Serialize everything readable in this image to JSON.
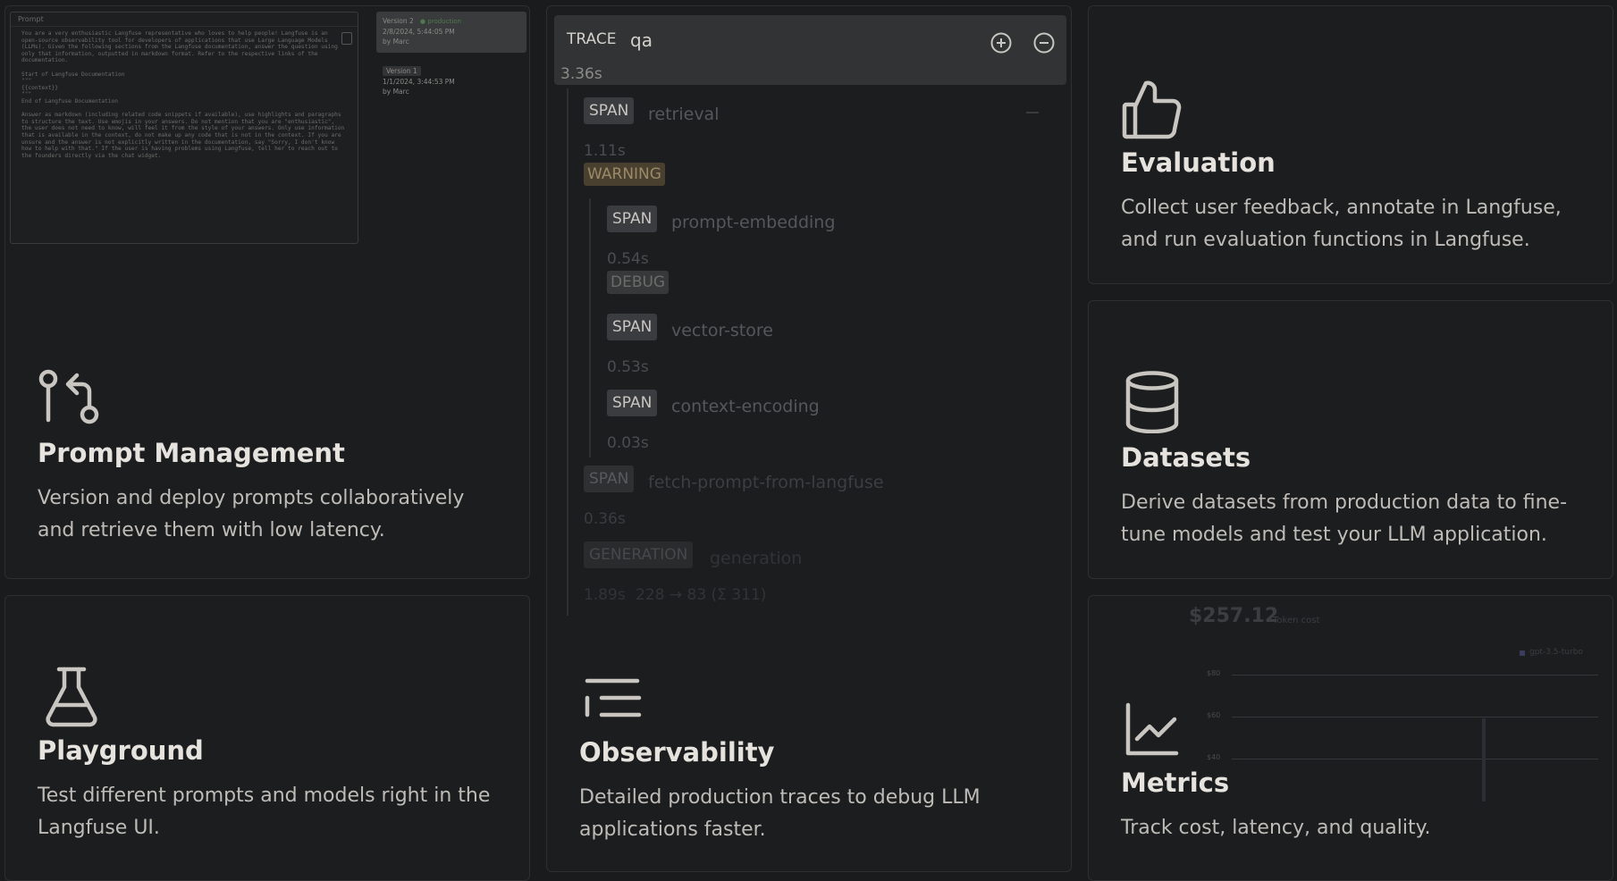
{
  "colors": {
    "background": "#1a1b1d",
    "card": "#1c1d1f",
    "border": "#2e2f31",
    "warning": "#e8b56a",
    "production": "#4caf50"
  },
  "prompt_management": {
    "title": "Prompt Management",
    "description": "Version and deploy prompts collaboratively and retrieve them with low latency.",
    "icon": "git-pull-request-icon",
    "preview": {
      "editor_label": "Prompt",
      "prompt_text": "You are a very enthusiastic Langfuse representative who loves to help people! Langfuse is an open-source observability tool for developers of applications that use Large Language Models (LLMs). Given the following sections from the Langfuse documentation, answer the question using only that information, outputted in markdown format. Refer to the respective links of the documentation.\n\nStart of Langfuse Documentation\n\"\"\"\n{{context}}\n\"\"\"\nEnd of Langfuse Documentation\n\nAnswer as markdown (including related code snippets if available), use highlights and paragraphs to structure the text. Use emojis in your answers. Do not mention that you are \"enthusiastic\", the user does not need to know, will feel it from the style of your answers. Only use information that is available in the context, do not make up any code that is not in the context. If you are unsure and the answer is not explicitly written in the documentation, say \"Sorry, I don't know how to help with that.\" If the user is having problems using Langfuse, tell her to reach out to the founders directly via the chat widget.",
      "versions": [
        {
          "label": "Version 2",
          "tag": "production",
          "date": "2/8/2024, 5:44:05 PM",
          "author": "by Marc"
        },
        {
          "label": "Version 1",
          "date": "1/1/2024, 3:44:53 PM",
          "author": "by Marc"
        }
      ]
    }
  },
  "observability": {
    "title": "Observability",
    "description": "Detailed production traces to debug LLM applications faster.",
    "icon": "list-tree-icon",
    "trace": {
      "type": "TRACE",
      "name": "qa",
      "duration": "3.36s",
      "spans": [
        {
          "type": "SPAN",
          "name": "retrieval",
          "duration": "1.11s",
          "level": "WARNING"
        },
        {
          "type": "SPAN",
          "name": "prompt-embedding",
          "duration": "0.54s",
          "level": "DEBUG"
        },
        {
          "type": "SPAN",
          "name": "vector-store",
          "duration": "0.53s"
        },
        {
          "type": "SPAN",
          "name": "context-encoding",
          "duration": "0.03s"
        },
        {
          "type": "SPAN",
          "name": "fetch-prompt-from-langfuse",
          "duration": "0.36s"
        },
        {
          "type": "GENERATION",
          "name": "generation",
          "duration": "1.89s",
          "tokens": "228 → 83 (Σ 311)"
        }
      ]
    }
  },
  "evaluation": {
    "title": "Evaluation",
    "description": "Collect user feedback, annotate in Langfuse, and run evaluation functions in Langfuse.",
    "icon": "thumbs-up-icon"
  },
  "datasets": {
    "title": "Datasets",
    "description": "Derive datasets from production data to fine-tune models and test your LLM application.",
    "icon": "database-icon"
  },
  "playground": {
    "title": "Playground",
    "description": "Test different prompts and models right in the Langfuse UI.",
    "icon": "flask-icon"
  },
  "metrics": {
    "title": "Metrics",
    "description": "Track cost, latency, and quality.",
    "icon": "line-chart-icon",
    "preview": {
      "total": "$257.12",
      "total_label": "Token cost",
      "legend": "gpt-3.5-turbo",
      "y_ticks": [
        "$80",
        "$60",
        "$40"
      ],
      "bar_fraction": 0.62
    }
  }
}
